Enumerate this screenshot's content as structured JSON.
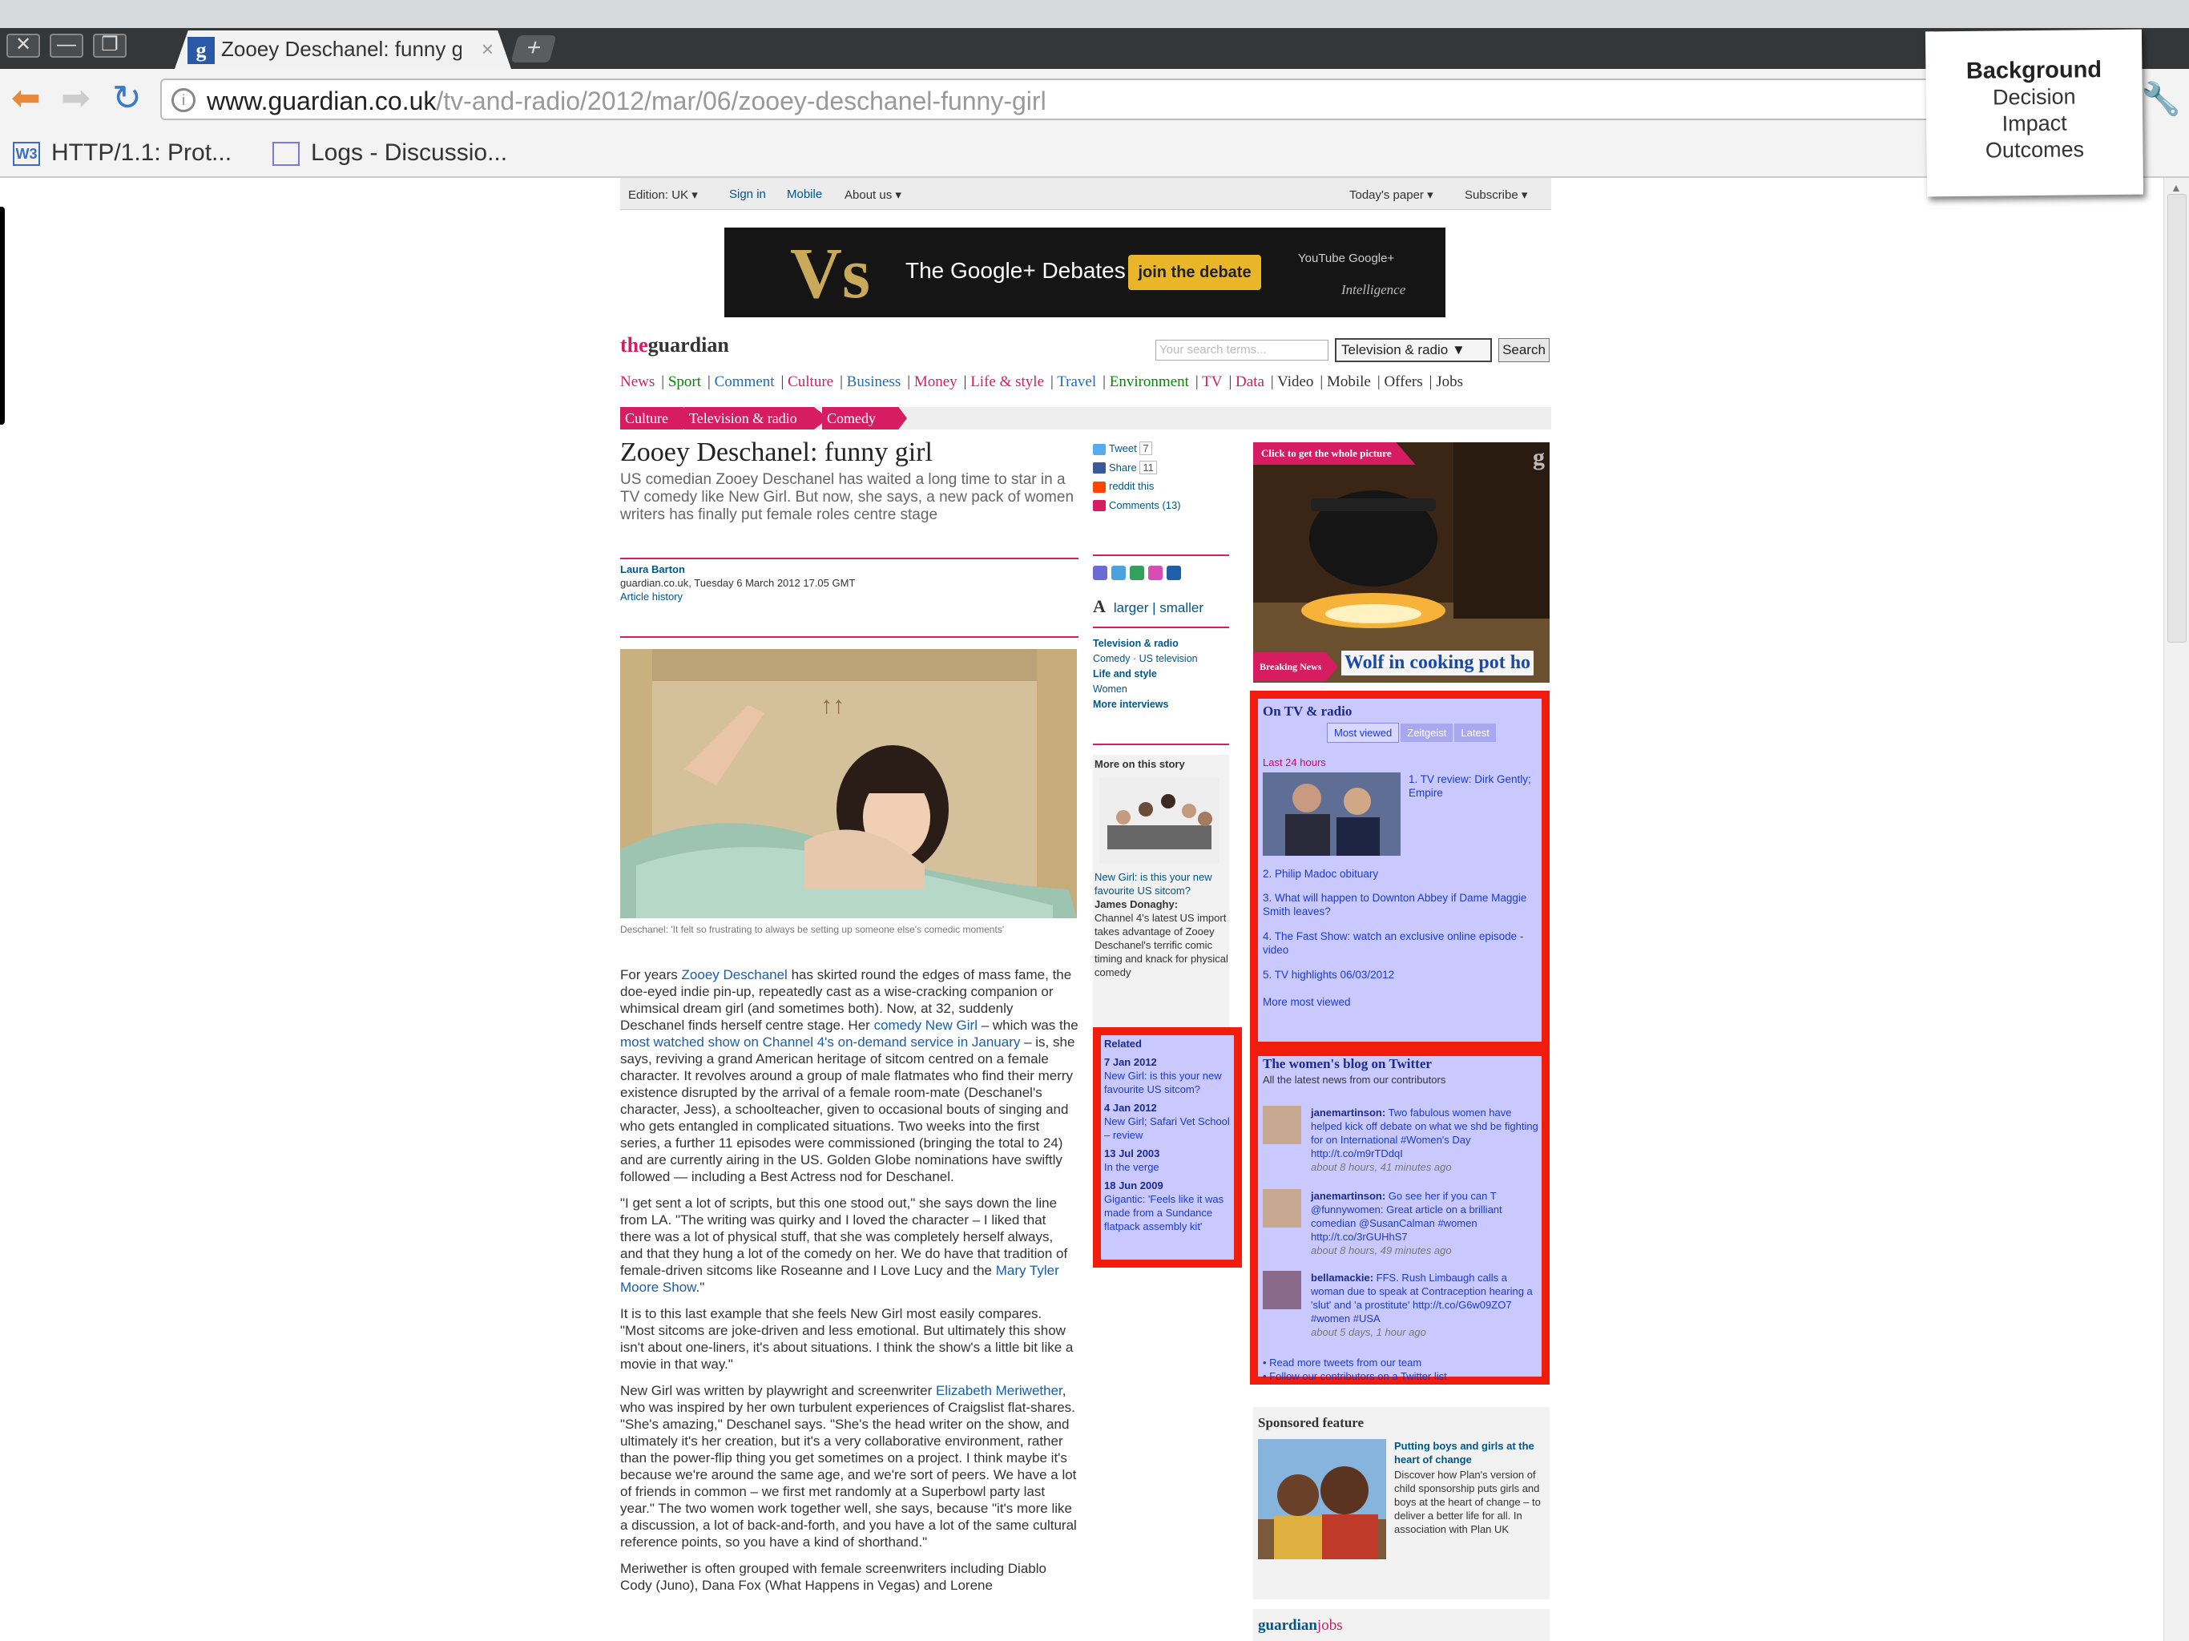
{
  "browser": {
    "tab_favicon": "g",
    "tab_title": "Zooey Deschanel: funny g",
    "tab_close": "×",
    "new_tab": "+",
    "window_buttons": [
      "✕",
      "—",
      "❐"
    ],
    "url_host": "www.guardian.co.uk",
    "url_path": "/tv-and-radio/2012/mar/06/zooey-deschanel-funny-girl",
    "bookmarks": [
      {
        "icon": "W3",
        "label": "HTTP/1.1: Prot..."
      },
      {
        "icon": "",
        "label": "Logs - Discussio..."
      }
    ]
  },
  "sticky_note": {
    "items": [
      "Background",
      "Decision",
      "Impact",
      "Outcomes"
    ]
  },
  "page": {
    "topbar": {
      "edition": "Edition: UK ▾",
      "signin": "Sign in",
      "mobile": "Mobile",
      "about": "About us ▾",
      "todays_paper": "Today's paper ▾",
      "subscribe": "Subscribe ▾"
    },
    "ad": {
      "vs": "Vs",
      "text": "The Google+ Debates",
      "button": "join the debate",
      "logos": "YouTube Google+",
      "intel": "Intelligence"
    },
    "logo_the": "the",
    "logo_guardian": "guardian",
    "search": {
      "placeholder": "Your search terms...",
      "scope": "Television & radio ▼",
      "button": "Search"
    },
    "nav": [
      "News",
      "Sport",
      "Comment",
      "Culture",
      "Business",
      "Money",
      "Life & style",
      "Travel",
      "Environment",
      "TV",
      "Data",
      "Video",
      "Mobile",
      "Offers",
      "Jobs"
    ],
    "breadcrumbs": [
      "Culture",
      "Television & radio",
      "Comedy"
    ],
    "headline": "Zooey Deschanel: funny girl",
    "standfirst": "US comedian Zooey Deschanel has waited a long time to star in a TV comedy like New Girl. But now, she says, a new pack of women writers has finally put female roles centre stage",
    "byline": {
      "name": "Laura Barton",
      "meta": "guardian.co.uk, Tuesday 6 March 2012 17.05 GMT",
      "history": "Article history"
    },
    "caption": "Deschanel: 'It felt so frustrating to always be setting up someone else's comedic moments'",
    "body": {
      "p1_a": "For years ",
      "p1_link1": "Zooey Deschanel",
      "p1_b": " has skirted round the edges of mass fame, the doe-eyed indie pin-up, repeatedly cast as a wise-cracking companion or whimsical dream girl (and sometimes both). Now, at 32, suddenly Deschanel finds herself centre stage. Her ",
      "p1_link2": "comedy New Girl",
      "p1_c": " – which was the ",
      "p1_link3": "most watched show on Channel 4's on-demand service in January",
      "p1_d": " – is, she says, reviving a grand American heritage of sitcom centred on a female character. It revolves around a group of male flatmates who find their merry existence disrupted by the arrival of a female room-mate (Deschanel's character, Jess), a schoolteacher, given to occasional bouts of singing and who gets entangled in complicated situations. Two weeks into the first series, a further 11 episodes were commissioned (bringing the total to 24) and are currently airing in the US. Golden Globe nominations have swiftly followed — including a Best Actress nod for Deschanel.",
      "p2_a": "\"I get sent a lot of scripts, but this one stood out,\" she says down the line from LA. \"The writing was quirky and I loved the character – I liked that there was a lot of physical stuff, that she was completely herself always, and that they hung a lot of the comedy on her. We do have that tradition of female-driven sitcoms like Roseanne and I Love Lucy and the ",
      "p2_link": "Mary Tyler Moore Show",
      "p2_b": ".\"",
      "p3": "It is to this last example that she feels New Girl most easily compares. \"Most sitcoms are joke-driven and less emotional. But ultimately this show isn't about one-liners, it's about situations. I think the show's a little bit like a movie in that way.\"",
      "p4_a": "New Girl was written by playwright and screenwriter ",
      "p4_link": "Elizabeth Meriwether",
      "p4_b": ", who was inspired by her own turbulent experiences of Craigslist flat-shares. \"She's amazing,\" Deschanel says. \"She's the head writer on the show, and ultimately it's her creation, but it's a very collaborative environment, rather than the power-flip thing you get sometimes on a project. I think maybe it's because we're around the same age, and we're sort of peers. We have a lot of friends in common – we first met randomly at a Superbowl party last year.\" The two women work together well, she says, because \"it's more like a discussion, a lot of back-and-forth, and you have a lot of the same cultural reference points, so you have a kind of shorthand.\"",
      "p5": "Meriwether is often grouped with female screenwriters including Diablo Cody (Juno), Dana Fox (What Happens in Vegas) and Lorene"
    },
    "share": {
      "tweet": "Tweet",
      "tweet_count": "7",
      "share": "Share",
      "share_count": "11",
      "reddit": "reddit this",
      "comments": "Comments (13)"
    },
    "textsize": {
      "a": "A",
      "label": "larger | smaller"
    },
    "keywords": [
      {
        "head": "Television & radio",
        "items": "Comedy · US television"
      },
      {
        "head": "Life and style",
        "items": "Women"
      },
      {
        "head": "More interviews",
        "items": ""
      }
    ],
    "more_story": {
      "title": "More on this story",
      "link": "New Girl: is this your new favourite US sitcom?",
      "name": "James Donaghy:",
      "text": "Channel 4's latest US import takes advantage of Zooey Deschanel's terrific comic timing and knack for physical comedy"
    },
    "related": {
      "title": "Related",
      "items": [
        {
          "date": "7 Jan 2012",
          "text": "New Girl: is this your new favourite US sitcom?"
        },
        {
          "date": "4 Jan 2012",
          "text": "New Girl; Safari Vet School – review"
        },
        {
          "date": "13 Jul 2003",
          "text": "In the verge"
        },
        {
          "date": "18 Jun 2009",
          "text": "Gigantic: 'Feels like it was made from a Sundance flatpack assembly kit'"
        }
      ]
    },
    "picture": {
      "label": "Click to get the whole picture",
      "g": "g",
      "breaking": "Breaking News",
      "headline": "Wolf in cooking pot ho"
    },
    "tv": {
      "title": "On TV & radio",
      "tabs": [
        "Most viewed",
        "Zeitgeist",
        "Latest"
      ],
      "last": "Last 24 hours",
      "items": [
        "1. TV review: Dirk Gently; Empire",
        "2. Philip Madoc obituary",
        "3. What will happen to Downton Abbey if Dame Maggie Smith leaves?",
        "4. The Fast Show: watch an exclusive online episode - video",
        "5. TV highlights 06/03/2012"
      ],
      "more": "More most viewed"
    },
    "twitter": {
      "title": "The women's blog on Twitter",
      "sub": "All the latest news from our contributors",
      "tweets": [
        {
          "user": "janemartinson:",
          "text": " Two fabulous women have helped kick off debate on what we shd be fighting for on International #Women's Day http://t.co/m9rTDdqI",
          "time": "about 8 hours, 41 minutes ago"
        },
        {
          "user": "janemartinson:",
          "text": " Go see her if you can T @funnywomen: Great article on a brilliant comedian @SusanCalman #women http://t.co/3rGUHhS7",
          "time": "about 8 hours, 49 minutes ago"
        },
        {
          "user": "bellamackie:",
          "text": " FFS. Rush Limbaugh calls a woman due to speak at Contraception hearing a 'slut' and 'a prostitute' http://t.co/G6w09ZO7 #women #USA",
          "time": "about 5 days, 1 hour ago"
        }
      ],
      "link1": "• Read more tweets from our team",
      "link2": "• Follow our contributors on a Twitter list"
    },
    "sponsored": {
      "title": "Sponsored feature",
      "head": "Putting boys and girls at the heart of change",
      "body": "Discover how Plan's version of child sponsorship puts girls and boys at the heart of change – to deliver a better life for all. In association with Plan UK"
    },
    "jobs": {
      "a": "guardian",
      "b": "jobs"
    }
  }
}
